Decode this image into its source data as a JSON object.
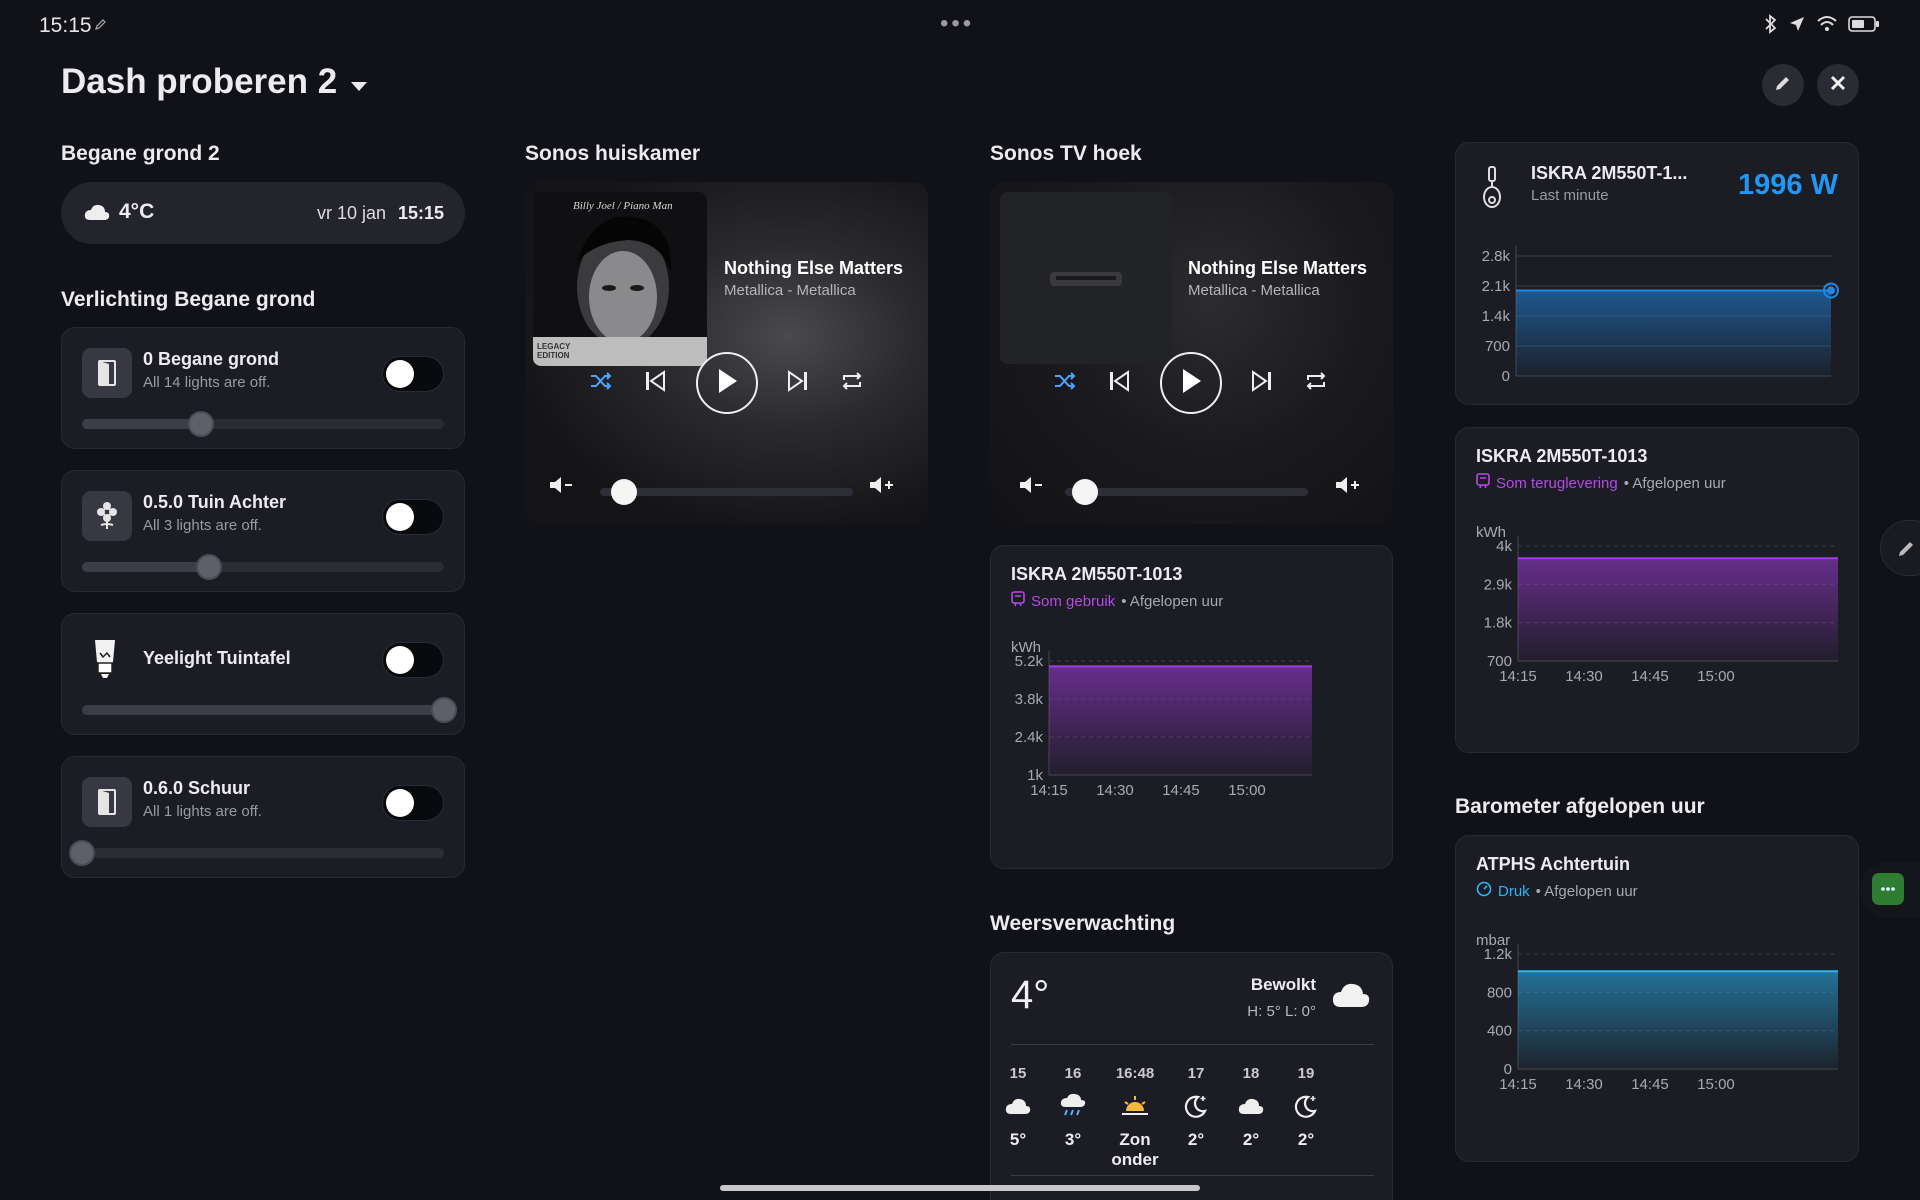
{
  "status": {
    "time": "15:15"
  },
  "dashboard": {
    "title": "Dash proberen 2"
  },
  "colors": {
    "purple": "#a43be0",
    "blue": "#1e88e5",
    "cyan": "#29b6f6",
    "green": "#2e7d32"
  },
  "col1": {
    "section1": "Begane grond 2",
    "weather_pill": {
      "temp": "4°C",
      "date": "vr 10 jan",
      "time": "15:15",
      "icon": "cloud-icon"
    },
    "section2": "Verlichting Begane grond",
    "lights": [
      {
        "name": "0 Begane grond",
        "sub": "All 14 lights are off.",
        "icon": "door-icon",
        "level": 0.33
      },
      {
        "name": "0.5.0 Tuin Achter",
        "sub": "All 3 lights are off.",
        "icon": "flower-icon",
        "level": 0.35
      },
      {
        "name": "Yeelight Tuintafel",
        "sub": "",
        "icon": "bulb-icon",
        "level": 1.0
      },
      {
        "name": "0.6.0 Schuur",
        "sub": "All 1 lights are off.",
        "icon": "door-icon",
        "level": 0.0
      }
    ]
  },
  "col2": {
    "title": "Sonos huiskamer",
    "track": "Nothing Else Matters",
    "artist": "Metallica - Metallica",
    "album_text": "Billy Joel / Piano Man",
    "album_badge": "LEGACY EDITION",
    "volume": 0.16
  },
  "col3": {
    "title": "Sonos TV hoek",
    "track": "Nothing Else Matters",
    "artist": "Metallica - Metallica",
    "volume": 0.16,
    "graph": {
      "title": "ISKRA 2M550T-1013",
      "metric": "Som gebruik",
      "period": "• Afgelopen uur"
    },
    "weather_title": "Weersverwachting",
    "weather": {
      "temp": "4°",
      "cond": "Bewolkt",
      "hl": "H: 5° L: 0°",
      "forecast": [
        {
          "label": "15",
          "icon": "cloud-icon",
          "temp": "5°"
        },
        {
          "label": "16",
          "icon": "cloud-rain-icon",
          "temp": "3°"
        },
        {
          "label": "16:48",
          "icon": "sunset-icon",
          "temp": "Zon onder"
        },
        {
          "label": "17",
          "icon": "moon-icon",
          "temp": "2°"
        },
        {
          "label": "18",
          "icon": "cloud-icon",
          "temp": "2°"
        },
        {
          "label": "19",
          "icon": "moon-icon",
          "temp": "2°"
        }
      ]
    }
  },
  "col4": {
    "power": {
      "name": "ISKRA 2M550T-1...",
      "sub": "Last minute",
      "value": "1996 W"
    },
    "graph": {
      "title": "ISKRA 2M550T-1013",
      "metric": "Som teruglevering",
      "period": "• Afgelopen uur"
    },
    "baro_section": "Barometer afgelopen uur",
    "baro": {
      "title": "ATPHS Achtertuin",
      "metric": "Druk",
      "period": "• Afgelopen uur"
    }
  },
  "chart_data": [
    {
      "type": "area",
      "title": "ISKRA 2M550T-1...",
      "x_ticks": [],
      "y_ticks": [
        "0",
        "700",
        "1.4k",
        "2.1k",
        "2.8k"
      ],
      "ylim": [
        0,
        2800
      ],
      "series": [
        {
          "values": [
            1996,
            1996,
            1996,
            1996,
            1996
          ]
        }
      ]
    },
    {
      "type": "area",
      "title": "ISKRA 2M550T-1013",
      "ylabel": "kWh",
      "x_ticks": [
        "14:15",
        "14:30",
        "14:45",
        "15:00"
      ],
      "y_ticks": [
        "1k",
        "2.4k",
        "3.8k",
        "5.2k"
      ],
      "ylim": [
        1000,
        5200
      ],
      "series": [
        {
          "name": "Som gebruik",
          "values": [
            5000,
            5000,
            5000,
            5000,
            5000
          ]
        }
      ]
    },
    {
      "type": "area",
      "title": "ISKRA 2M550T-1013",
      "ylabel": "kWh",
      "x_ticks": [
        "14:15",
        "14:30",
        "14:45",
        "15:00"
      ],
      "y_ticks": [
        "700",
        "1.8k",
        "2.9k",
        "4k"
      ],
      "ylim": [
        700,
        4000
      ],
      "series": [
        {
          "name": "Som teruglevering",
          "values": [
            3650,
            3650,
            3650,
            3650,
            3650
          ]
        }
      ]
    },
    {
      "type": "area",
      "title": "ATPHS Achtertuin",
      "ylabel": "mbar",
      "x_ticks": [
        "14:15",
        "14:30",
        "14:45",
        "15:00"
      ],
      "y_ticks": [
        "0",
        "400",
        "800",
        "1.2k"
      ],
      "ylim": [
        0,
        1200
      ],
      "series": [
        {
          "name": "Druk",
          "values": [
            1020,
            1020,
            1020,
            1020,
            1020
          ]
        }
      ]
    }
  ]
}
